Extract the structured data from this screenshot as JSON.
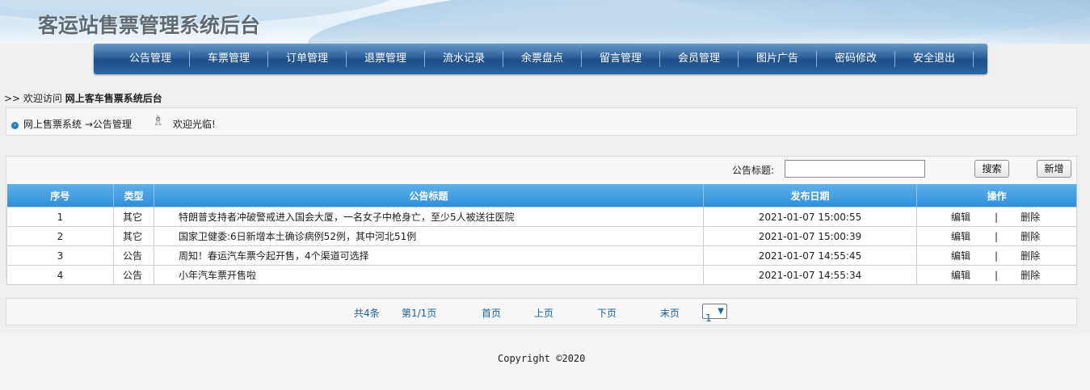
{
  "header": {
    "title": "客运站售票管理系统后台"
  },
  "nav": [
    "公告管理",
    "车票管理",
    "订单管理",
    "退票管理",
    "流水记录",
    "余票盘点",
    "留言管理",
    "会员管理",
    "图片广告",
    "密码修改",
    "安全退出"
  ],
  "welcome": {
    "prefix": ">> 欢迎访问",
    "site": "网上客车售票系统后台"
  },
  "breadcrumb": {
    "path": "网上售票系统 →公告管理",
    "greeting": "欢迎光临!"
  },
  "search": {
    "label": "公告标题:",
    "value": "",
    "search_button": "搜索",
    "add_button": "新增"
  },
  "table": {
    "headers": [
      "序号",
      "类型",
      "公告标题",
      "发布日期",
      "操作"
    ],
    "rows": [
      {
        "no": "1",
        "type": "其它",
        "title": "特朗普支持者冲破警戒进入国会大厦，一名女子中枪身亡，至少5人被送往医院",
        "date": "2021-01-07 15:00:55",
        "edit": "编辑",
        "sep": "|",
        "delete": "删除"
      },
      {
        "no": "2",
        "type": "其它",
        "title": "国家卫健委:6日新增本土确诊病例52例，其中河北51例",
        "date": "2021-01-07 15:00:39",
        "edit": "编辑",
        "sep": "|",
        "delete": "删除"
      },
      {
        "no": "3",
        "type": "公告",
        "title": "周知！春运汽车票今起开售，4个渠道可选择",
        "date": "2021-01-07 14:55:45",
        "edit": "编辑",
        "sep": "|",
        "delete": "删除"
      },
      {
        "no": "4",
        "type": "公告",
        "title": "小年汽车票开售啦",
        "date": "2021-01-07 14:55:34",
        "edit": "编辑",
        "sep": "|",
        "delete": "删除"
      }
    ]
  },
  "pager": {
    "total": "共4条",
    "current": "第1/1页",
    "first": "首页",
    "prev": "上页",
    "next": "下页",
    "last": "末页",
    "selected_page": "1"
  },
  "footer": {
    "copyright": "Copyright ©2020"
  },
  "colors": {
    "nav_bg": "#2a5f99",
    "table_header": "#2f8fd8",
    "link": "#1b5f9e"
  },
  "icons": {
    "bullet": "circle-arrow-icon",
    "greeting": "person-icon"
  }
}
